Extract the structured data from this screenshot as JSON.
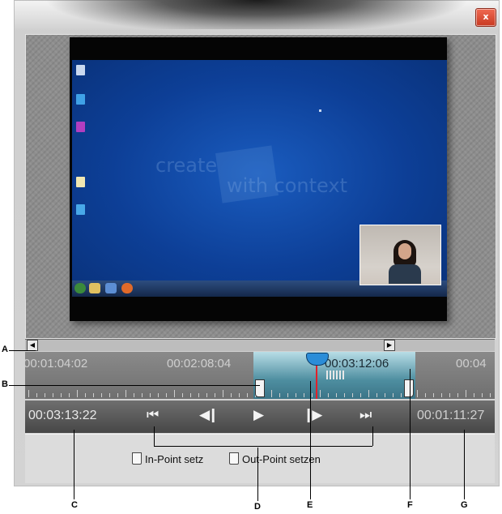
{
  "window": {
    "close_glyph": "x"
  },
  "video": {
    "watermark_line1": "create",
    "watermark_line2": "with context"
  },
  "scrollbar": {
    "left_arrow": "◀",
    "right_arrow": "▶"
  },
  "timeline": {
    "labels": [
      "00:01:04:02",
      "00:02:08:04",
      "00:03:12:06",
      "00:04"
    ]
  },
  "transport": {
    "current_time": "00:03:13:22",
    "duration": "00:01:11:27",
    "buttons": {
      "go_to_in": "⏮",
      "step_back": "◀❙",
      "play": "▶",
      "step_forward": "❙▶",
      "go_to_out": "⏭"
    }
  },
  "footer": {
    "set_in_point": "In-Point setz",
    "set_out_point": "Out-Point setzen"
  },
  "callouts": {
    "a": "A",
    "b": "B",
    "c": "C",
    "d": "D",
    "e": "E",
    "f": "F",
    "g": "G"
  }
}
